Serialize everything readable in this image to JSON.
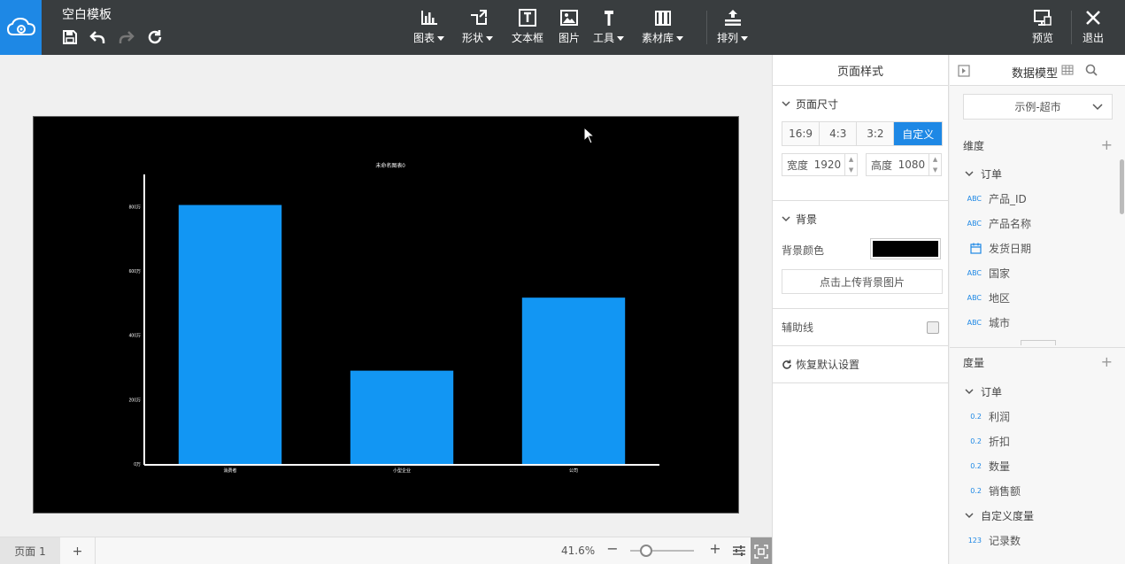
{
  "app": {
    "title": "空白模板"
  },
  "toolbar": {
    "items": [
      {
        "label": "图表",
        "icon": "bar-chart-icon",
        "dropdown": true
      },
      {
        "label": "形状",
        "icon": "shape-icon",
        "dropdown": true
      },
      {
        "label": "文本框",
        "icon": "textbox-icon",
        "dropdown": false
      },
      {
        "label": "图片",
        "icon": "image-icon",
        "dropdown": false
      },
      {
        "label": "工具",
        "icon": "hammer-icon",
        "dropdown": true
      },
      {
        "label": "素材库",
        "icon": "library-icon",
        "dropdown": true
      },
      {
        "label": "排列",
        "icon": "arrange-icon",
        "dropdown": true
      }
    ],
    "preview_label": "预览",
    "exit_label": "退出"
  },
  "chart_data": {
    "type": "bar",
    "title": "未命名图表0",
    "categories": [
      "消费者",
      "小型企业",
      "公司"
    ],
    "values": [
      8050000,
      2900000,
      5170000
    ],
    "y_ticks": [
      "0万",
      "200万",
      "400万",
      "600万",
      "800万"
    ],
    "ylim": [
      0,
      9000000
    ],
    "bar_color": "#1296f3",
    "background": "#000000",
    "axis_color": "#ffffff"
  },
  "bottom": {
    "page_tab": "页面 1",
    "add_page": "+",
    "zoom": "41.6%",
    "zoom_fraction": 0.25
  },
  "style_panel": {
    "title": "页面样式",
    "page_size_label": "页面尺寸",
    "ratios": [
      "16:9",
      "4:3",
      "3:2",
      "自定义"
    ],
    "active_ratio": "自定义",
    "width_label": "宽度",
    "width_value": "1920",
    "height_label": "高度",
    "height_value": "1080",
    "background_label": "背景",
    "bg_color_label": "背景颜色",
    "bg_color": "#000000",
    "upload_bg_label": "点击上传背景图片",
    "guide_label": "辅助线",
    "reset_label": "恢复默认设置"
  },
  "model_panel": {
    "title": "数据模型",
    "dataset": "示例-超市",
    "dimensions_label": "维度",
    "dimension_folder": "订单",
    "dimensions": [
      {
        "type": "ABC",
        "name": "产品_ID"
      },
      {
        "type": "ABC",
        "name": "产品名称"
      },
      {
        "type": "date",
        "name": "发货日期"
      },
      {
        "type": "ABC",
        "name": "国家"
      },
      {
        "type": "ABC",
        "name": "地区"
      },
      {
        "type": "ABC",
        "name": "城市"
      }
    ],
    "measures_label": "度量",
    "measure_folder": "订单",
    "measures": [
      {
        "type": "0.2",
        "name": "利润"
      },
      {
        "type": "0.2",
        "name": "折扣"
      },
      {
        "type": "0.2",
        "name": "数量"
      },
      {
        "type": "0.2",
        "name": "销售额"
      }
    ],
    "custom_folder": "自定义度量",
    "custom_measures": [
      {
        "type": "123",
        "name": "记录数"
      }
    ]
  }
}
